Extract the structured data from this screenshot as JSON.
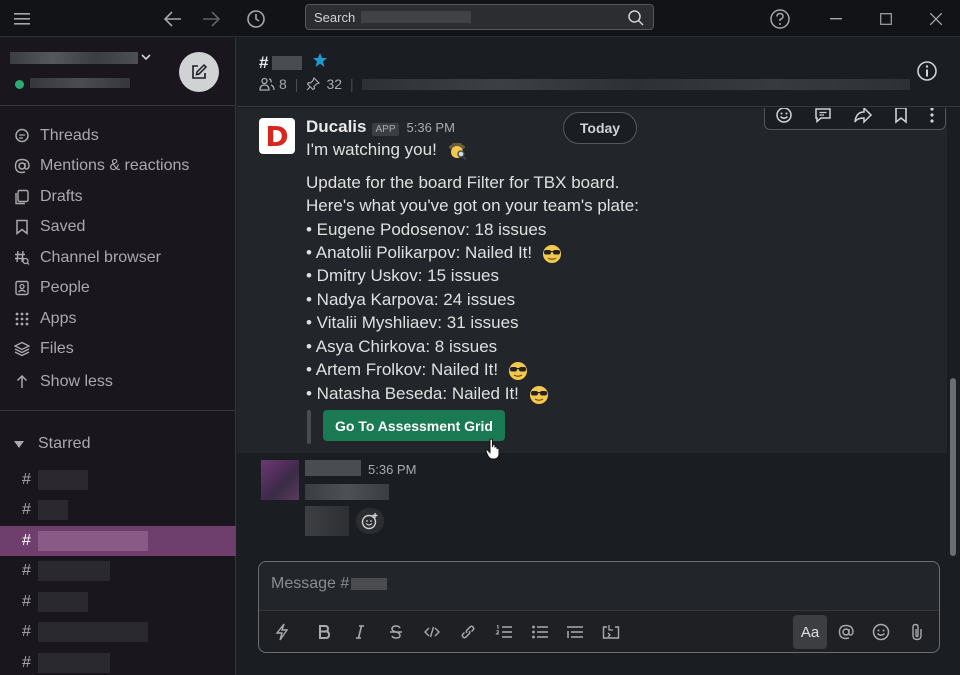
{
  "topbar": {
    "search_label": "Search"
  },
  "sidebar": {
    "nav": [
      {
        "label": "Threads",
        "icon": "threads-icon"
      },
      {
        "label": "Mentions & reactions",
        "icon": "at-icon"
      },
      {
        "label": "Drafts",
        "icon": "drafts-icon"
      },
      {
        "label": "Saved",
        "icon": "bookmark-icon"
      },
      {
        "label": "Channel browser",
        "icon": "channel-browser-icon"
      },
      {
        "label": "People",
        "icon": "people-icon"
      },
      {
        "label": "Apps",
        "icon": "apps-icon"
      },
      {
        "label": "Files",
        "icon": "files-icon"
      },
      {
        "label": "Show less",
        "icon": "arrow-up-icon"
      }
    ],
    "starred_label": "Starred",
    "channel_hash": "#"
  },
  "header": {
    "hash": "#",
    "member_count": "8",
    "pinned_count": "32"
  },
  "today_label": "Today",
  "message": {
    "sender": "Ducalis",
    "badge": "APP",
    "time": "5:36 PM",
    "avatar_letter": "D",
    "line1": "I'm watching you!",
    "line2": "Update for the board Filter for TBX board.",
    "line3": "Here's what you've got on your team's plate:",
    "items": [
      "• Eugene Podosenov: 18 issues",
      "• Anatolii Polikarpov: Nailed It!",
      "• Dmitry Uskov: 15 issues",
      "• Nadya Karpova: 24 issues",
      "• Vitalii Myshliaev: 31 issues",
      "• Asya Chirkova: 8 issues",
      "• Artem Frolkov: Nailed It!",
      "• Natasha Beseda: Nailed It!"
    ],
    "button_label": "Go To Assessment Grid"
  },
  "message2": {
    "time": "5:36 PM"
  },
  "composer": {
    "placeholder": "Message #",
    "aa_label": "Aa"
  },
  "colors": {
    "accent_active": "#6e3f6c",
    "button_green": "#1a7a54",
    "star_blue": "#1d9bd1",
    "online_green": "#2bac76"
  }
}
